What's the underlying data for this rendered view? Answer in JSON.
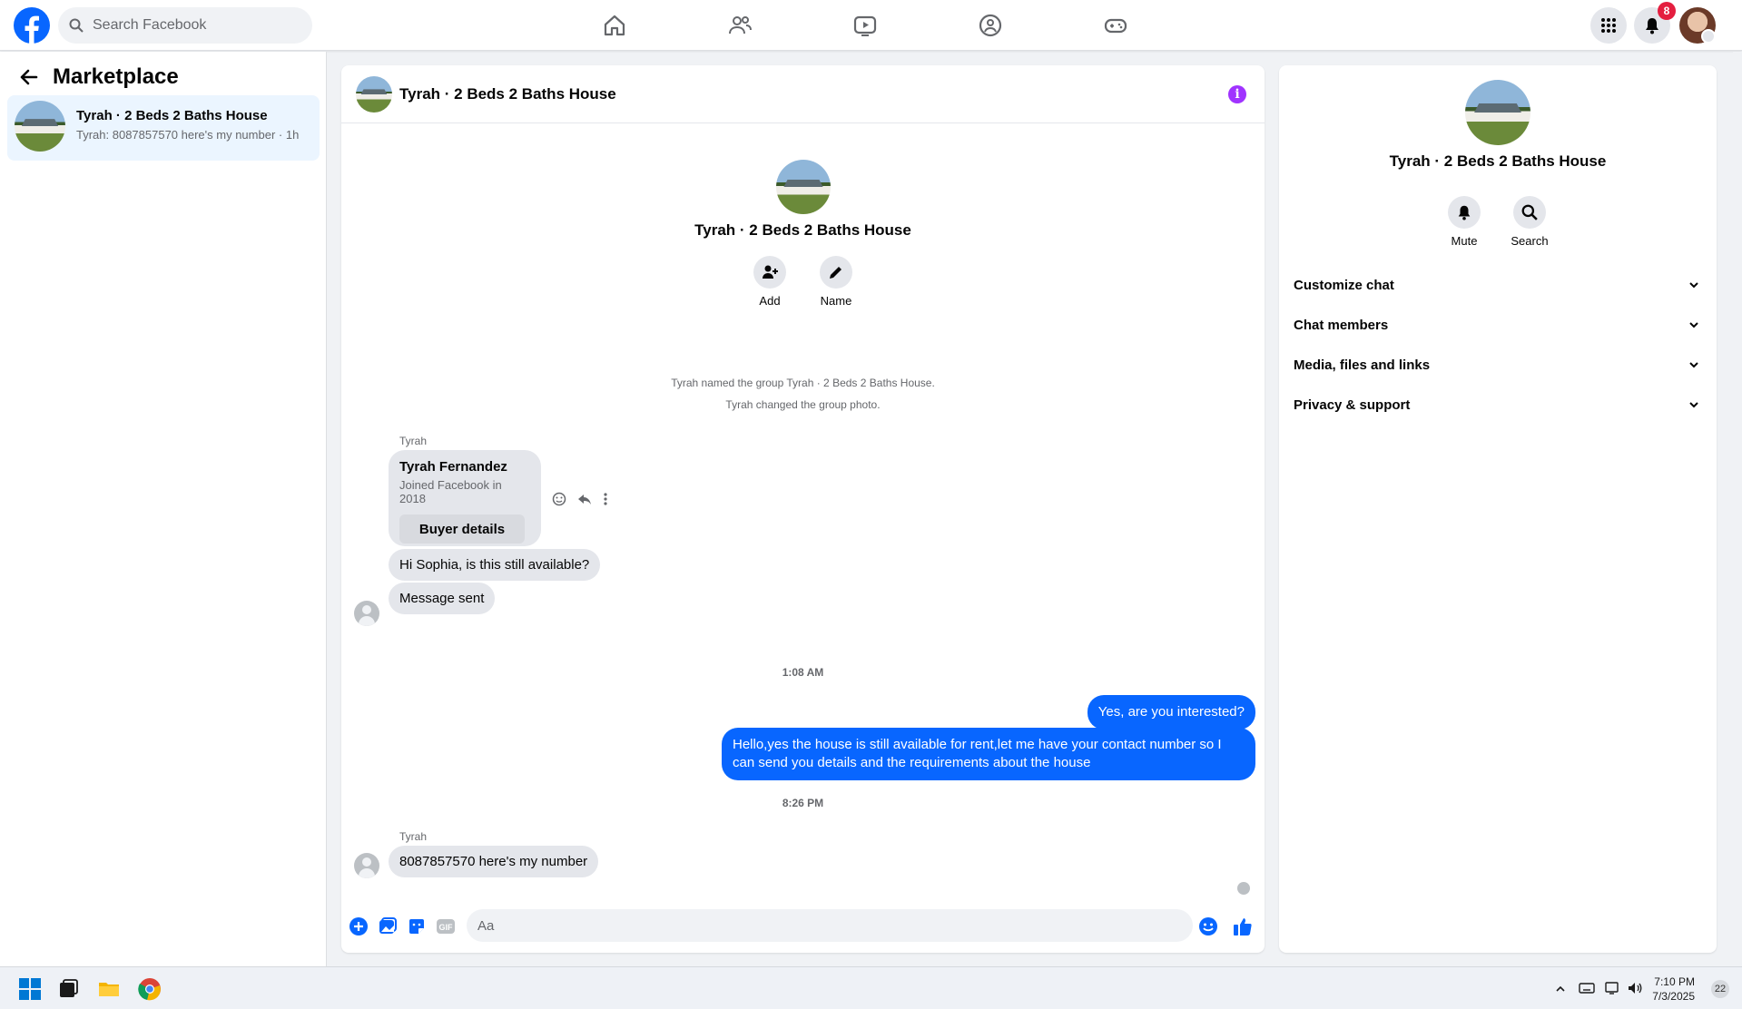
{
  "topbar": {
    "search_placeholder": "Search Facebook",
    "notification_count": "8",
    "icons": [
      "home-icon",
      "friends-icon",
      "watch-icon",
      "groups-icon",
      "gaming-icon",
      "menu-grid-icon",
      "bell-icon"
    ]
  },
  "sidebar": {
    "title": "Marketplace",
    "conversations": [
      {
        "title": "Tyrah · 2 Beds 2 Baths House",
        "preview": "Tyrah: 8087857570 here's my number · 1h"
      }
    ]
  },
  "chat": {
    "header_title": "Tyrah · 2 Beds 2 Baths House",
    "intro_name": "Tyrah · 2 Beds 2 Baths House",
    "intro_actions": [
      "Add",
      "Name"
    ],
    "system_messages": [
      "Tyrah named the group Tyrah · 2 Beds 2 Baths House.",
      "Tyrah changed the group photo."
    ],
    "sender_1": "Tyrah",
    "buyer_card": {
      "name": "Tyrah Fernandez",
      "joined": "Joined Facebook in 2018",
      "button": "Buyer details"
    },
    "incoming_1": "Hi Sophia, is this still available?",
    "incoming_2": "Message sent",
    "timestamp_1": "1:08 AM",
    "outgoing_1": "Yes, are you interested?",
    "outgoing_2": "Hello,yes the house is still available for rent,let me have your contact number   so I can send you details and the requirements about the house",
    "timestamp_2": "8:26 PM",
    "sender_2": "Tyrah",
    "incoming_3": "8087857570 here's my number",
    "composer_placeholder": "Aa"
  },
  "details": {
    "name": "Tyrah · 2 Beds 2 Baths House",
    "actions": [
      "Mute",
      "Search"
    ],
    "sections": [
      "Customize chat",
      "Chat members",
      "Media, files and links",
      "Privacy & support"
    ]
  },
  "taskbar": {
    "time": "7:10 PM",
    "date": "7/3/2025",
    "notification_count": "22"
  },
  "colors": {
    "accent": "#0866ff",
    "info": "#a033ff",
    "badge": "#e41e3f"
  }
}
